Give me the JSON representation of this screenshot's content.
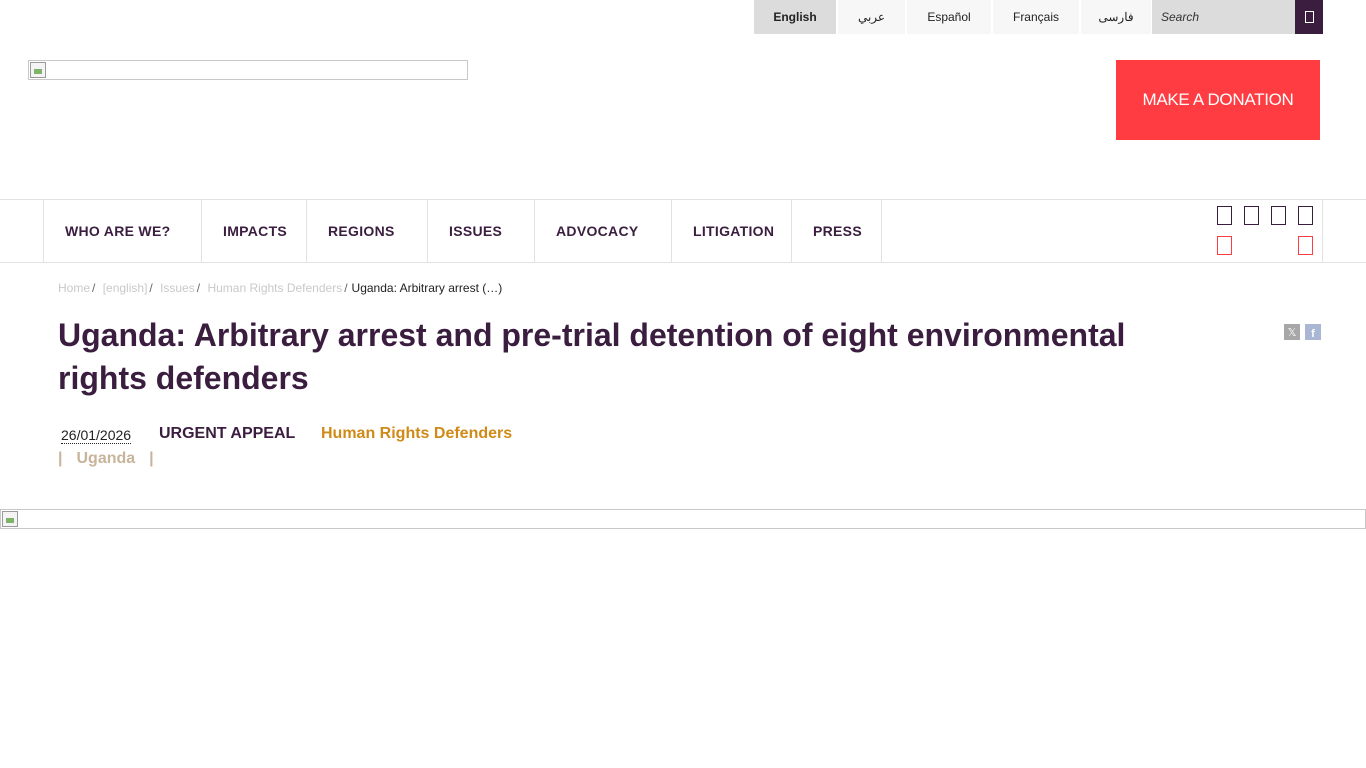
{
  "languages": [
    {
      "label": "English",
      "active": true
    },
    {
      "label": "عربي",
      "active": false
    },
    {
      "label": "Español",
      "active": false
    },
    {
      "label": "Français",
      "active": false
    },
    {
      "label": "فارسی",
      "active": false
    }
  ],
  "search": {
    "placeholder": "Search",
    "icon": "search-icon"
  },
  "header": {
    "donate_label": "MAKE A DONATION",
    "logo_icon": "broken-image-icon"
  },
  "nav": {
    "items": [
      "WHO ARE WE?",
      "IMPACTS",
      "REGIONS",
      "ISSUES",
      "ADVOCACY",
      "LITIGATION",
      "PRESS"
    ]
  },
  "social_icons": [
    "social-icon",
    "social-icon",
    "social-icon",
    "social-icon",
    "social-icon",
    "social-icon"
  ],
  "breadcrumb": {
    "items": [
      "Home",
      "[english]",
      "Issues",
      "Human Rights Defenders"
    ],
    "current": "Uganda: Arbitrary arrest (…)"
  },
  "article": {
    "title": "Uganda: Arbitrary arrest and pre-trial detention of eight environmental rights defenders",
    "date": "26/01/2026",
    "type": "URGENT APPEAL",
    "tag": "Human Rights Defenders",
    "country": "Uganda",
    "separator": "|"
  },
  "share": {
    "x_label": "𝕏",
    "fb_label": "f"
  },
  "colors": {
    "brand_purple": "#3a1d3f",
    "donate_red": "#ff3c42",
    "tag_orange": "#cf8a17",
    "country_tan": "#c7b49b"
  }
}
